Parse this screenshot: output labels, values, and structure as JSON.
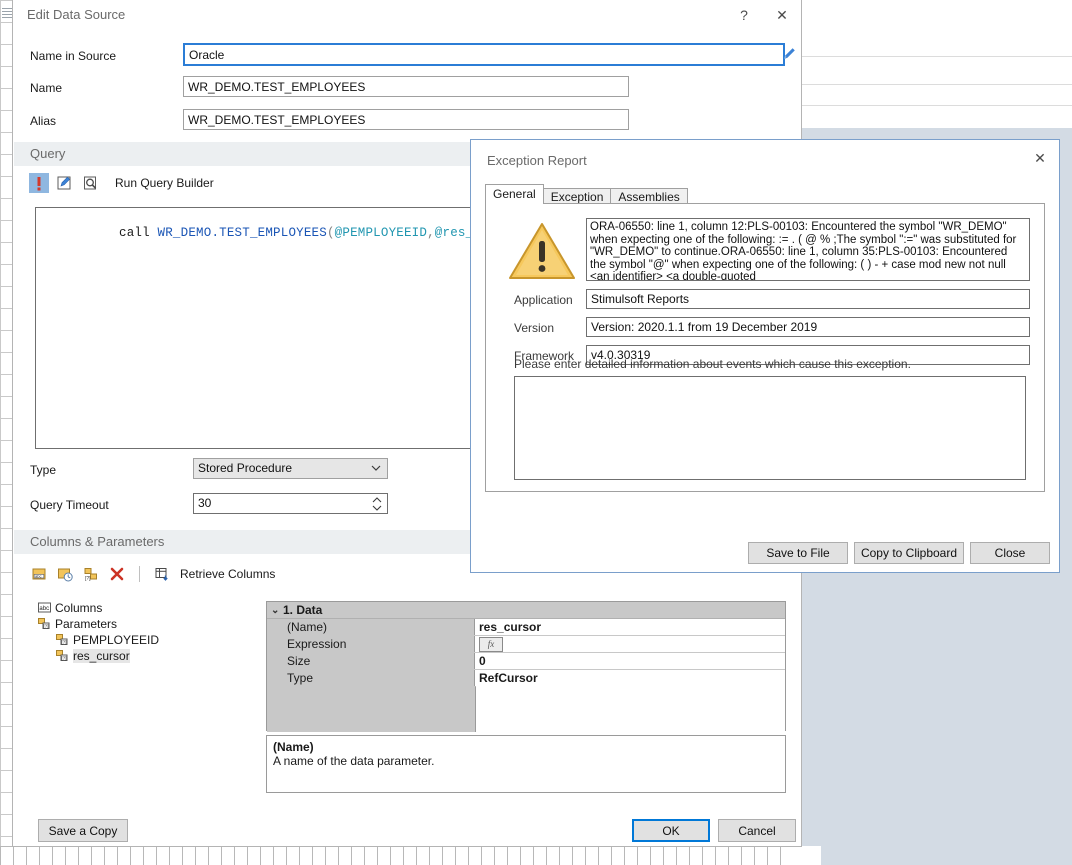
{
  "background": {
    "app_name": "report-designer-canvas"
  },
  "edit_data_source": {
    "title": "Edit Data Source",
    "help_label": "?",
    "close_label": "✕",
    "fields": {
      "name_in_source_label": "Name in Source",
      "name_in_source_value": "Oracle",
      "name_label": "Name",
      "name_value": "WR_DEMO.TEST_EMPLOYEES",
      "alias_label": "Alias",
      "alias_value": "WR_DEMO.TEST_EMPLOYEES"
    },
    "query_section": {
      "header": "Query",
      "toolbar": {
        "error_icon": "error-exclamation-icon",
        "edit_icon": "edit-query-icon",
        "preview_icon": "preview-query-icon",
        "run_query_builder": "Run Query Builder"
      },
      "sql_parts": {
        "call": "call ",
        "proc": "WR_DEMO.TEST_EMPLOYEES",
        "open_paren": "(",
        "param1": "@PEMPLOYEEID",
        "comma": ",",
        "param2": "@res_cursor",
        "close_paren": ")"
      },
      "sql_full": "call WR_DEMO.TEST_EMPLOYEES(@PEMPLOYEEID,@res_cursor)"
    },
    "type_label": "Type",
    "type_value": "Stored Procedure",
    "query_timeout_label": "Query Timeout",
    "query_timeout_value": "30",
    "columns_section": {
      "header": "Columns & Parameters",
      "toolbar": {
        "new_column_icon": "new-column-icon",
        "new_calc_column_icon": "new-calculated-column-icon",
        "new_parameter_icon": "new-parameter-icon",
        "delete_icon": "delete-red-x-icon",
        "retrieve_columns_icon": "retrieve-columns-icon",
        "retrieve_columns": "Retrieve Columns"
      },
      "tree": [
        {
          "label": "Columns",
          "icon": "abc-columns-icon",
          "indent": 0,
          "selected": false
        },
        {
          "label": "Parameters",
          "icon": "parameters-icon",
          "indent": 0,
          "selected": false
        },
        {
          "label": "PEMPLOYEEID",
          "icon": "parameter-item-icon",
          "indent": 1,
          "selected": false
        },
        {
          "label": "res_cursor",
          "icon": "parameter-item-icon",
          "indent": 1,
          "selected": true
        }
      ],
      "property_grid": {
        "category": "1. Data",
        "expander": "⌄",
        "rows": [
          {
            "name": "(Name)",
            "value": "res_cursor",
            "kind": "text"
          },
          {
            "name": "Expression",
            "value": "fx",
            "kind": "button"
          },
          {
            "name": "Size",
            "value": "0",
            "kind": "text"
          },
          {
            "name": "Type",
            "value": "RefCursor",
            "kind": "text"
          }
        ]
      },
      "description": {
        "title": "(Name)",
        "text": "A name of the data parameter."
      }
    },
    "buttons": {
      "save_a_copy": "Save a Copy",
      "ok": "OK",
      "cancel": "Cancel"
    }
  },
  "exception_report": {
    "title": "Exception Report",
    "close_label": "✕",
    "tabs": [
      {
        "label": "General",
        "active": true
      },
      {
        "label": "Exception",
        "active": false
      },
      {
        "label": "Assemblies",
        "active": false
      }
    ],
    "warning_icon": "warning-triangle-icon",
    "error_text": "ORA-06550: line 1, column 12:PLS-00103: Encountered the symbol \"WR_DEMO\" when expecting one of the following:   := . ( @ % ;The symbol \":=\" was substituted for \"WR_DEMO\" to continue.ORA-06550: line 1, column 35:PLS-00103: Encountered the symbol \"@\" when expecting one of the following:   ( ) - + case mod new not null <an identifier>   <a double-quoted",
    "application_label": "Application",
    "application_value": "Stimulsoft Reports",
    "version_label": "Version",
    "version_value": "Version: 2020.1.1 from 19 December 2019",
    "framework_label": "Framework",
    "framework_value": "v4.0.30319",
    "note": "Please enter detailed information about events which cause this exception.",
    "details_value": "",
    "details_placeholder": "",
    "buttons": {
      "save_to_file": "Save to File",
      "copy_to_clipboard": "Copy to Clipboard",
      "close": "Close"
    }
  },
  "colors": {
    "accent": "#0078d7",
    "dialog_border": "#2b7dd6",
    "section_header_bg": "#eceff1",
    "desktop_bg": "#d3dbe4",
    "warning_yellow": "#f5c242",
    "error_red": "#d33a2c",
    "sql_keyword": "#1a55b5",
    "sql_param": "#2196b0"
  }
}
